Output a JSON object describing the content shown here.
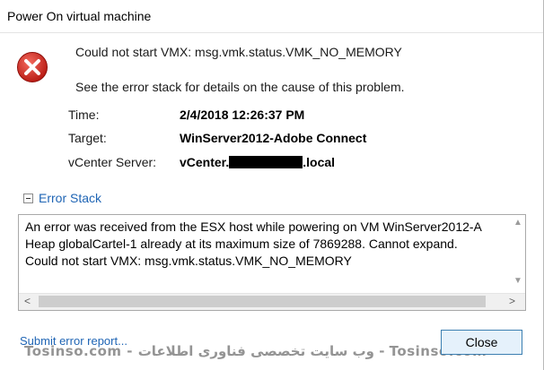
{
  "window": {
    "title": "Power On virtual machine"
  },
  "message": {
    "primary": "Could not start VMX: msg.vmk.status.VMK_NO_MEMORY",
    "secondary": "See the error stack for details on the cause of this problem."
  },
  "details": [
    {
      "label": "Time:",
      "value": "2/4/2018 12:26:37 PM"
    },
    {
      "label": "Target:",
      "value": "WinServer2012-Adobe Connect"
    },
    {
      "label": "vCenter Server:",
      "value_prefix": "vCenter.",
      "value_suffix": ".local"
    }
  ],
  "error_stack": {
    "label": "Error Stack",
    "lines": [
      "An error was received from the ESX host while powering on VM WinServer2012-A",
      "Heap globalCartel-1 already at its maximum size of 7869288. Cannot expand.",
      "Could not start VMX: msg.vmk.status.VMK_NO_MEMORY"
    ]
  },
  "footer": {
    "submit_link": "Submit error report...",
    "close_button": "Close",
    "watermark": "Tosinso.com - وب سایت تخصصی فناوری اطلاعات - Tosinso.com"
  },
  "colors": {
    "link": "#1e64b4",
    "error_icon": "#d7281f",
    "button_border": "#3c7fb1"
  },
  "icons": [
    "error-icon",
    "collapse-icon",
    "scroll-up-icon",
    "scroll-down-icon",
    "scroll-left-icon",
    "scroll-right-icon"
  ]
}
